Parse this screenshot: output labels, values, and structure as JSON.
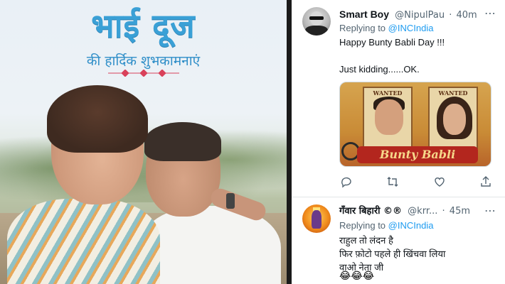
{
  "poster": {
    "title": "भाई दूज",
    "subtitle": "की हार्दिक शुभकामनाएं"
  },
  "tweets": [
    {
      "display_name": "Smart Boy",
      "handle": "@NipulPau",
      "time": "40m",
      "replying_prefix": "Replying to",
      "replying_to": "@INCIndia",
      "lines": [
        "Happy Bunty Babli Day !!!",
        "Just kidding......OK."
      ],
      "media": {
        "label_left": "WANTED",
        "label_right": "WANTED",
        "title": "Bunty Babli"
      },
      "actions": [
        "reply-icon",
        "retweet-icon",
        "like-icon",
        "share-icon"
      ]
    },
    {
      "display_name": "गँवार बिहारी ©®",
      "handle": "@krr...",
      "time": "45m",
      "replying_prefix": "Replying to",
      "replying_to": "@INCIndia",
      "lines": [
        "राहुल तो लंदन है",
        "फिर फ़ोटो पहले ही खिंचवा लिया",
        "वाओ नेता जी"
      ],
      "emoji": "😂😂😂"
    }
  ],
  "icons": {
    "more": "⋯",
    "reply": "◯",
    "retweet": "⇄",
    "like": "♡",
    "share": "⇧"
  },
  "colors": {
    "link": "#1d9bf0",
    "muted": "#536471",
    "title_blue": "#3aa0d6"
  }
}
